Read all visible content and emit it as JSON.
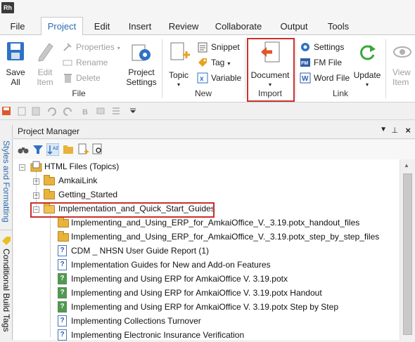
{
  "app": {
    "logo": "Rh"
  },
  "menu_tabs": [
    "File",
    "Project",
    "Edit",
    "Insert",
    "Review",
    "Collaborate",
    "Output",
    "Tools"
  ],
  "ribbon": {
    "save_all": "Save\nAll",
    "edit_item": "Edit\nItem",
    "properties": "Properties",
    "rename": "Rename",
    "delete": "Delete",
    "project_settings": "Project\nSettings",
    "group_file": "File",
    "topic": "Topic",
    "snippet": "Snippet",
    "tag": "Tag",
    "variable": "Variable",
    "group_new": "New",
    "document": "Document",
    "group_import": "Import",
    "settings": "Settings",
    "fm_file": "FM File",
    "word_file": "Word File",
    "update": "Update",
    "view_item": "View\nItem",
    "group_link": "Link"
  },
  "panel": {
    "title": "Project Manager",
    "side_tabs": [
      "Styles and Formatting",
      "Conditional Build Tags"
    ]
  },
  "tree": {
    "root": "HTML Files (Topics)",
    "folders": [
      "AmkaiLink",
      "Getting_Started",
      "Implementation_and_Quick_Start_Guides"
    ],
    "children": [
      {
        "label": "Implementing_and_Using_ERP_for_AmkaiOffice_V._3.19.potx_handout_files",
        "icon": "folder-icon"
      },
      {
        "label": "Implementing_and_Using_ERP_for_AmkaiOffice_V._3.19.potx_step_by_step_files",
        "icon": "folder-icon"
      },
      {
        "label": "CDM _ NHSN User Guide Report (1)",
        "icon": "topic-icon"
      },
      {
        "label": "Implementation Guides for New and Add-on Features",
        "icon": "topic-icon"
      },
      {
        "label": "Implementing and Using ERP for AmkaiOffice V. 3.19.potx",
        "icon": "topic-green-icon"
      },
      {
        "label": "Implementing and Using ERP for AmkaiOffice V. 3.19.potx Handout",
        "icon": "topic-green-icon"
      },
      {
        "label": "Implementing and Using ERP for AmkaiOffice V. 3.19.potx Step by Step",
        "icon": "topic-green-icon"
      },
      {
        "label": "Implementing Collections Turnover",
        "icon": "topic-icon"
      },
      {
        "label": "Implementing Electronic Insurance Verification",
        "icon": "topic-icon"
      }
    ]
  },
  "colors": {
    "accent": "#2b6cb0",
    "highlight": "#c9302c",
    "folder": "#e8b33a"
  }
}
